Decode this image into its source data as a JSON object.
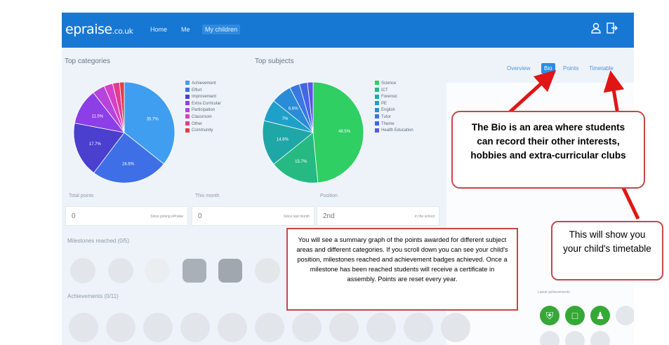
{
  "nav": {
    "logo": "epraise",
    "logo_domain": ".co.uk",
    "links": [
      "Home",
      "Me",
      "My children"
    ]
  },
  "top_categories": {
    "title": "Top categories",
    "legend": [
      "Achievement",
      "Effort",
      "Improvement",
      "Extra Curricular",
      "Participation",
      "Classroom",
      "Other",
      "Community"
    ],
    "colors": [
      "#3f9ef0",
      "#3f6fe6",
      "#4a3fcf",
      "#8c3fe6",
      "#b544dc",
      "#d63fc9",
      "#e23c8f",
      "#e63c45"
    ],
    "labels": [
      "35.7%",
      "24.6%",
      "17.7%",
      "11.5%"
    ]
  },
  "top_subjects": {
    "title": "Top subjects",
    "legend": [
      "Science",
      "ICT",
      "Forensic",
      "PE",
      "English",
      "Tutor",
      "Theme",
      "Health Education"
    ],
    "colors": [
      "#2fcf63",
      "#26ba82",
      "#1fa7a7",
      "#1fa0c8",
      "#2a8bd6",
      "#3a78e0",
      "#4466e2",
      "#5a58e0"
    ],
    "labels": [
      "48.5%",
      "15.7%",
      "14.6%",
      "7%",
      "6.6%"
    ]
  },
  "chart_data": [
    {
      "type": "pie",
      "title": "Top categories",
      "categories": [
        "Achievement",
        "Effort",
        "Improvement",
        "Extra Curricular",
        "Participation",
        "Classroom",
        "Other",
        "Community"
      ],
      "values": [
        35.7,
        24.6,
        17.7,
        11.5,
        4.0,
        2.8,
        2.2,
        1.5
      ]
    },
    {
      "type": "pie",
      "title": "Top subjects",
      "categories": [
        "Science",
        "ICT",
        "Forensic",
        "PE",
        "English",
        "Tutor",
        "Theme",
        "Health Education"
      ],
      "values": [
        48.5,
        15.7,
        14.6,
        7.0,
        6.6,
        3.2,
        2.6,
        1.8
      ]
    }
  ],
  "tabs": [
    "Overview",
    "Bio",
    "Points",
    "Timetable"
  ],
  "stats": [
    {
      "label": "Total points",
      "value": "0",
      "sub": "Since joining ePraise"
    },
    {
      "label": "This month",
      "value": "0",
      "sub": "Since last month"
    },
    {
      "label": "Position",
      "value": "2nd",
      "sub": "in the school"
    }
  ],
  "milestones_title": "Milestones reached (0/5)",
  "achievements_title": "Achievements (0/11)",
  "recent_badges_title": "Latest achievements",
  "callouts": {
    "bio": "The Bio is an area where students can record their other interests, hobbies and extra-curricular clubs",
    "timetable": "This will show you your child's timetable",
    "summary": "You will see a summary graph of the points awarded for different subject areas and different categories. If you scroll down you can see your child's position, milestones reached and achievement badges achieved. Once a milestone has been reached students will receive a certificate in assembly. Points are reset every year."
  }
}
